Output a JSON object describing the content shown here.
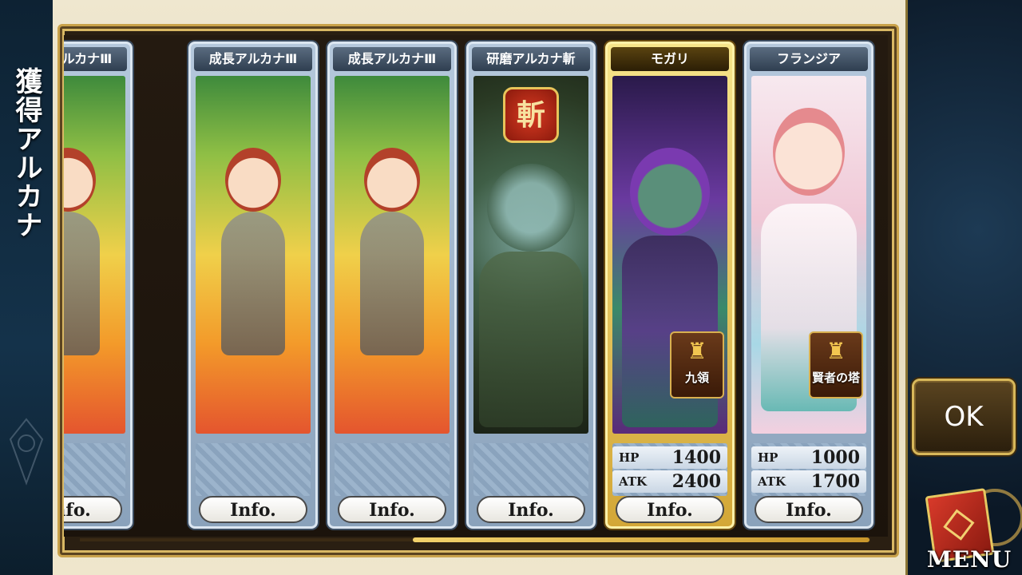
{
  "side_title": "獲得アルカナ",
  "cards": [
    {
      "name": "成長アルカナⅢ",
      "art": "fairy",
      "class_icon": "red",
      "class_glyph": "✚",
      "stars": "★★★",
      "info": "Info."
    },
    {
      "name": "成長アルカナⅢ",
      "art": "fairy",
      "class_icon": "gold",
      "class_glyph": "✥",
      "stars": "★★★",
      "info": "Info."
    },
    {
      "name": "成長アルカナⅢ",
      "art": "fairy",
      "class_icon": "purple",
      "class_glyph": "⚚",
      "stars": "★★★",
      "info": "Info."
    },
    {
      "name": "研磨アルカナ斬",
      "art": "stone",
      "badge": "斬",
      "stars": "★★★",
      "info": "Info."
    },
    {
      "name": "モガリ",
      "art": "mogari",
      "gold": true,
      "class_icon": "green",
      "class_glyph": "❀",
      "faction": "九領",
      "stars": "★★★★★",
      "hp_label": "HP",
      "hp": "1400",
      "atk_label": "ATK",
      "atk": "2400",
      "info": "Info."
    },
    {
      "name": "フランジア",
      "art": "fran",
      "class_icon": "purple",
      "class_glyph": "⚚",
      "faction": "賢者の塔",
      "stars": "★★★",
      "hp_label": "HP",
      "hp": "1000",
      "atk_label": "ATK",
      "atk": "1700",
      "info": "Info."
    }
  ],
  "ok_button": "OK",
  "menu_label": "MENU",
  "colors": {
    "accent_gold": "#c9a24a",
    "card_silver": "#b5c8dc",
    "card_gold": "#f6e48a"
  }
}
